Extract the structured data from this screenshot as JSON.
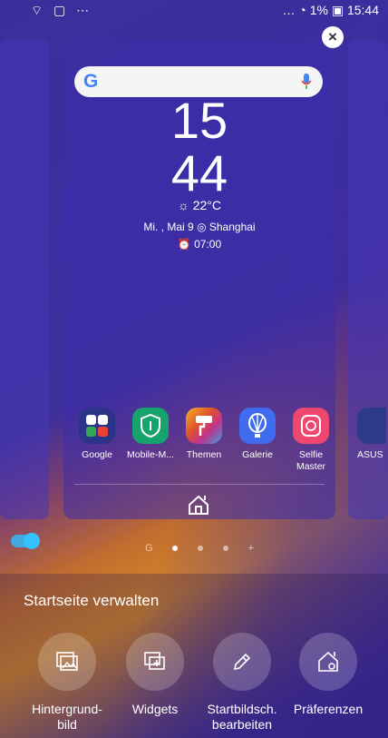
{
  "status_bar": {
    "left_icons": "⌔ ▢ ⋯",
    "right_text": "… ◔ 1% ▣ 15:44"
  },
  "home_preview": {
    "search_logo": "G",
    "clock_hour": "15",
    "clock_minute": "44",
    "weather": "☼ 22°C",
    "date_location": "Mi. , Mai 9 ◎ Shanghai",
    "alarm": "⏰ 07:00",
    "apps": [
      {
        "label": "Google",
        "color": "#2b3488"
      },
      {
        "label": "Mobile-M...",
        "color": "#16a36c"
      },
      {
        "label": "Themen",
        "color": "#e0522c"
      },
      {
        "label": "Galerie",
        "color": "#3f6bee"
      },
      {
        "label": "Selfie\nMaster",
        "color": "#f0476e"
      }
    ],
    "right_app_label": "ASUS"
  },
  "close_button": "×",
  "page_indicator": {
    "search": "G",
    "add": "+"
  },
  "manage": {
    "title": "Startseite verwalten",
    "actions": [
      {
        "label": "Hintergrund-\nbild",
        "icon": "wallpaper-icon"
      },
      {
        "label": "Widgets",
        "icon": "widgets-icon"
      },
      {
        "label": "Startbildsch.\nbearbeiten",
        "icon": "edit-icon"
      },
      {
        "label": "Präferenzen",
        "icon": "home-settings-icon"
      }
    ]
  }
}
